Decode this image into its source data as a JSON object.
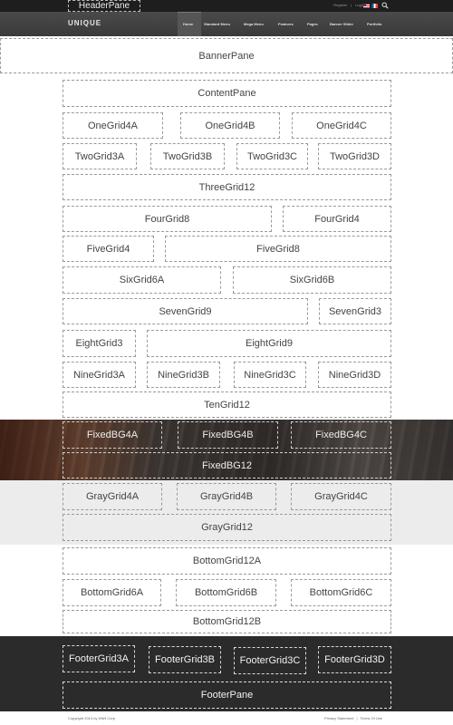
{
  "topbar": {
    "header_pane": "HeaderPane",
    "links": [
      "Register",
      "|",
      "Login"
    ]
  },
  "nav": {
    "logo": "UNIQUE",
    "items": [
      "Home",
      "Standard Menu",
      "Mega Menu",
      "Features",
      "Pages",
      "Banner Slider",
      "Portfolio"
    ]
  },
  "panes": {
    "banner": "BannerPane",
    "content": "ContentPane",
    "one_grid": [
      "OneGrid4A",
      "OneGrid4B",
      "OneGrid4C"
    ],
    "two_grid": [
      "TwoGrid3A",
      "TwoGrid3B",
      "TwoGrid3C",
      "TwoGrid3D"
    ],
    "three_grid": "ThreeGrid12",
    "four_grid": [
      "FourGrid8",
      "FourGrid4"
    ],
    "five_grid": [
      "FiveGrid4",
      "FiveGrid8"
    ],
    "six_grid": [
      "SixGrid6A",
      "SixGrid6B"
    ],
    "seven_grid": [
      "SevenGrid9",
      "SevenGrid3"
    ],
    "eight_grid": [
      "EightGrid3",
      "EightGrid9"
    ],
    "nine_grid": [
      "NineGrid3A",
      "NineGrid3B",
      "NineGrid3C",
      "NineGrid3D"
    ],
    "ten_grid": "TenGrid12",
    "fixed_bg": [
      "FixedBG4A",
      "FixedBG4B",
      "FixedBG4C"
    ],
    "fixed_bg12": "FixedBG12",
    "gray_grid": [
      "GrayGrid4A",
      "GrayGrid4B",
      "GrayGrid4C"
    ],
    "gray_grid12": "GrayGrid12",
    "bottom_grid12a": "BottomGrid12A",
    "bottom_grid6": [
      "BottomGrid6A",
      "BottomGrid6B",
      "BottomGrid6C"
    ],
    "bottom_grid12b": "BottomGrid12B",
    "footer_grid": [
      "FooterGrid3A",
      "FooterGrid3B",
      "FooterGrid3C",
      "FooterGrid3D"
    ],
    "footer_pane": "FooterPane"
  },
  "footer": {
    "copyright": "Copyright 2014 by DNN Corp",
    "links": [
      "Privacy Statement",
      "|",
      "Terms Of Use"
    ]
  },
  "colors": {
    "topbar": "#1e1e1e",
    "navbar": "#424242",
    "gray_band": "#ececec",
    "footer_band": "#2b2b2b"
  }
}
